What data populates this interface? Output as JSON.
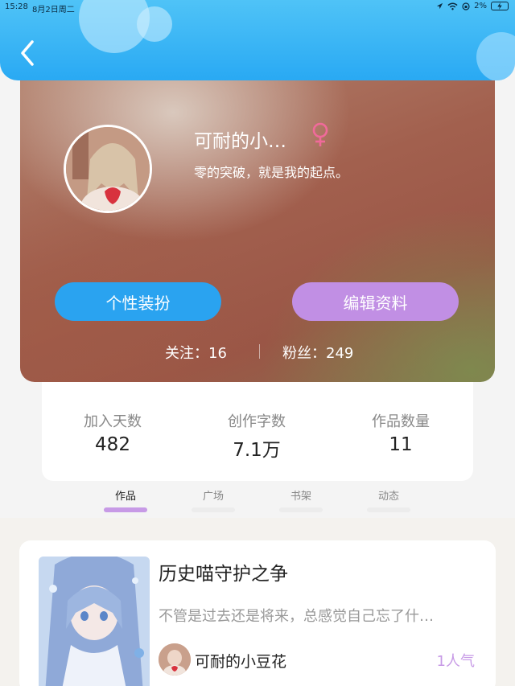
{
  "status_bar": {
    "time": "15:28",
    "date": "8月2日周二",
    "battery": "2%"
  },
  "profile": {
    "username": "可耐的小…",
    "bio": "零的突破，就是我的起点。",
    "gender_color": "#f06a9a",
    "buttons": {
      "dress_up": "个性装扮",
      "edit_profile": "编辑资料"
    },
    "follow": "关注：16",
    "fans": "粉丝：249"
  },
  "stats": [
    {
      "label": "加入天数",
      "value": "482"
    },
    {
      "label": "创作字数",
      "value": "7.1万"
    },
    {
      "label": "作品数量",
      "value": "11"
    }
  ],
  "tabs": [
    {
      "label": "作品",
      "active": true
    },
    {
      "label": "广场",
      "active": false
    },
    {
      "label": "书架",
      "active": false
    },
    {
      "label": "动态",
      "active": false
    }
  ],
  "work": {
    "title": "历史喵守护之争",
    "description": "不管是过去还是将来，总感觉自己忘了什…",
    "author": "可耐的小豆花",
    "popularity": "1人气"
  },
  "colors": {
    "header": "#29a9f3",
    "button_blue": "#2aa3f0",
    "button_purple": "#c18fe4",
    "accent_purple": "#c79ae6"
  }
}
